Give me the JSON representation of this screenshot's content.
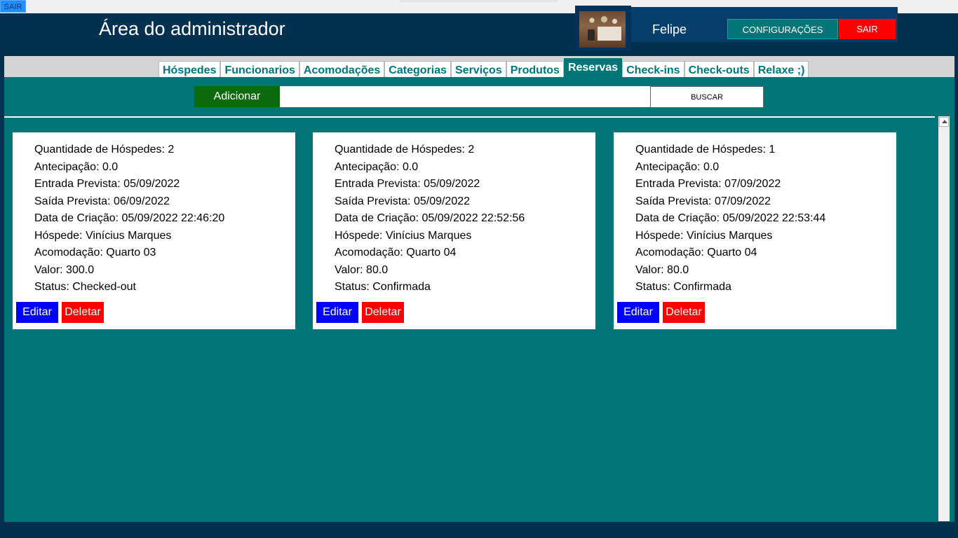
{
  "titlebar": {
    "button_label": "SAIR"
  },
  "header": {
    "title": "Área do administrador",
    "user_name": "Felipe",
    "config_label": "CONFIGURAÇÕES",
    "logout_label": "SAIR"
  },
  "tabs": [
    {
      "label": "Hóspedes",
      "active": false
    },
    {
      "label": "Funcionarios",
      "active": false
    },
    {
      "label": "Acomodações",
      "active": false
    },
    {
      "label": "Categorias",
      "active": false
    },
    {
      "label": "Serviços",
      "active": false
    },
    {
      "label": "Produtos",
      "active": false
    },
    {
      "label": "Reservas",
      "active": true
    },
    {
      "label": "Check-ins",
      "active": false
    },
    {
      "label": "Check-outs",
      "active": false
    },
    {
      "label": "Relaxe ;)",
      "active": false
    }
  ],
  "toolbar": {
    "add_label": "Adicionar",
    "search_value": "",
    "search_label": "BUSCAR"
  },
  "reservations": [
    {
      "lines": [
        "Quantidade de Hóspedes: 2",
        "Antecipação: 0.0",
        "Entrada Prevista: 05/09/2022",
        "Saída Prevista: 06/09/2022",
        "Data de Criação: 05/09/2022 22:46:20",
        "Hóspede: Vinícius Marques",
        "Acomodação: Quarto 03",
        "Valor: 300.0",
        "Status: Checked-out"
      ],
      "edit_label": "Editar",
      "delete_label": "Deletar"
    },
    {
      "lines": [
        "Quantidade de Hóspedes: 2",
        "Antecipação: 0.0",
        "Entrada Prevista: 05/09/2022",
        "Saída Prevista: 05/09/2022",
        "Data de Criação: 05/09/2022 22:52:56",
        "Hóspede: Vinícius Marques",
        "Acomodação: Quarto 04",
        "Valor: 80.0",
        "Status: Confirmada"
      ],
      "edit_label": "Editar",
      "delete_label": "Deletar"
    },
    {
      "lines": [
        "Quantidade de Hóspedes: 1",
        "Antecipação: 0.0",
        "Entrada Prevista: 07/09/2022",
        "Saída Prevista: 07/09/2022",
        "Data de Criação: 05/09/2022 22:53:44",
        "Hóspede: Vinícius Marques",
        "Acomodação: Quarto 04",
        "Valor: 80.0",
        "Status: Confirmada"
      ],
      "edit_label": "Editar",
      "delete_label": "Deletar"
    }
  ],
  "colors": {
    "header_bg": "#02304f",
    "content_bg": "#007577",
    "add_button": "#0a6b0a",
    "edit_button": "#0000ff",
    "delete_button": "#ff0000"
  }
}
